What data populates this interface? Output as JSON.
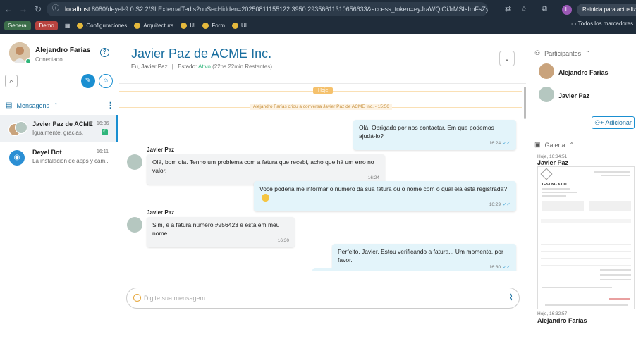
{
  "browser": {
    "url_host": "localhost",
    "url_rest": ":8080/deyel-9.0.S2.2/SLExternalTedis?nuSecHidden=20250811155122.3950.29356611310656633&access_token=eyJraWQiOiJrMSIsImFsZyI6IlJTMjIn0.eyJpc...",
    "restart_label": "Reinicia para actualizar",
    "profile_letter": "L",
    "bookmarks": {
      "tag_general": "General",
      "tag_demo": "Demo",
      "items": [
        "Configuraciones",
        "Arquitectura",
        "UI",
        "Form",
        "UI"
      ],
      "all_label": "Todos los marcadores"
    }
  },
  "sidebar": {
    "user_name": "Alejandro Farías",
    "user_status": "Conectado",
    "section_label": "Mensagens",
    "conversations": [
      {
        "name": "Javier Paz de ACME Inc.",
        "time": "16:36",
        "last": "Igualmente, gracias."
      },
      {
        "name": "Deyel Bot",
        "time": "16:11",
        "last": "La instalación de apps y cam..."
      }
    ]
  },
  "chat": {
    "title": "Javier Paz de ACME Inc.",
    "participants_line": "Eu, Javier Paz",
    "separator": "|",
    "status_label": "Estado:",
    "status_value": "Ativo",
    "remaining": "(22hs 22min Restantes)",
    "day_label": "Hoje",
    "system_message": "Alejandro Farías criou a conversa Javier Paz de ACME Inc. - 15:56",
    "messages": [
      {
        "dir": "out",
        "text": "Olá! Obrigado por nos contactar. Em que podemos ajudá-lo?",
        "time": "16:24"
      },
      {
        "dir": "in",
        "sender": "Javier Paz",
        "text": "Olá, bom dia. Tenho um problema com a fatura que recebi, acho que há um erro no valor.",
        "time": "16:24"
      },
      {
        "dir": "out",
        "text": "Você poderia me informar o número da sua fatura ou o nome com o qual ela está registrada?",
        "time": "16:29"
      },
      {
        "dir": "in",
        "sender": "Javier Paz",
        "text": "Sim, é a fatura número #256423 e está em meu nome.",
        "time": "16:30"
      },
      {
        "dir": "out",
        "text": "Perfeito, Javier. Estou verificando a fatura... Um momento, por favor.",
        "time": "16:30"
      }
    ],
    "composer_placeholder": "Digite sua mensagem..."
  },
  "right": {
    "participants_label": "Participantes",
    "participants": [
      "Alejandro Farías",
      "Javier Paz"
    ],
    "add_label": "Adicionar",
    "gallery_label": "Galeria",
    "gallery": [
      {
        "time": "Hoje, 16:34:51",
        "name": "Javier Paz"
      },
      {
        "time": "Hoje, 16:32:57",
        "name": "Alejandro Farías"
      }
    ],
    "invoice_title": "TESTING & CO"
  },
  "colors": {
    "accent": "#1a8fd1",
    "title": "#1a6fa0",
    "active": "#2fb57a",
    "system": "#f5c16c"
  }
}
